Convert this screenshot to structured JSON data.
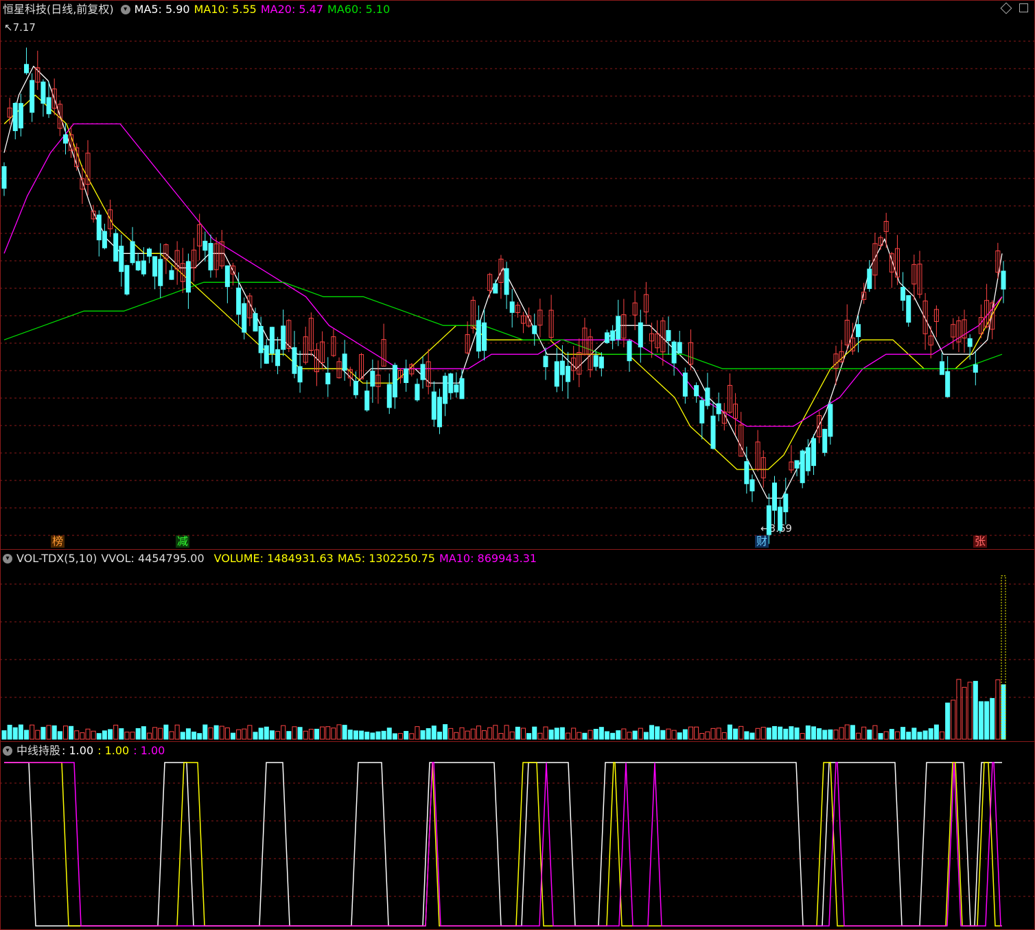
{
  "price_header": {
    "title": "恒星科技(日线,前复权)",
    "ma5": "MA5: 5.90",
    "ma10": "MA10: 5.55",
    "ma20": "MA20: 5.47",
    "ma60": "MA60: 5.10"
  },
  "vol_header": {
    "name": "VOL-TDX(5,10)",
    "vvol": "VVOL: 4454795.00",
    "volume": "VOLUME: 1484931.63",
    "ma5": "MA5: 1302250.75",
    "ma10": "MA10: 869943.31"
  },
  "ind_header": {
    "name": "中线持股",
    "v1": ": 1.00",
    "v2": ": 1.00",
    "v3": ": 1.00"
  },
  "annotations": {
    "high": "7.17",
    "low": "3.69",
    "tag_bang": "榜",
    "tag_jian": "减",
    "tag_cai": "财",
    "tag_zhang": "张"
  },
  "colors": {
    "up": "#ff4444",
    "down": "#54ffff",
    "ma5": "#ffffff",
    "ma10": "#ffff00",
    "ma20": "#ff00ff",
    "ma60": "#00dd00",
    "grid": "#8b1a1a"
  },
  "chart_data": [
    {
      "type": "candlestick",
      "title": "恒星科技(日线,前复权)",
      "ylim": [
        3.69,
        7.17
      ],
      "series": [
        {
          "name": "MA5",
          "values": [
            6.3,
            6.7,
            6.9,
            6.8,
            6.5,
            6.2,
            5.9,
            5.7,
            5.6,
            5.6,
            5.6,
            5.6,
            5.5,
            5.5,
            5.6,
            5.6,
            5.4,
            5.2,
            5.0,
            5.0,
            4.9,
            4.9,
            4.8,
            4.8,
            4.7,
            4.8,
            4.8,
            4.8,
            4.8,
            4.7,
            4.7,
            4.7,
            5.0,
            5.3,
            5.5,
            5.3,
            5.1,
            4.9,
            4.9,
            4.8,
            4.9,
            5.0,
            5.1,
            5.1,
            5.1,
            5.0,
            4.9,
            4.8,
            4.6,
            4.5,
            4.3,
            4.1,
            3.9,
            3.9,
            4.1,
            4.3,
            4.5,
            4.8,
            5.1,
            5.5,
            5.7,
            5.4,
            5.3,
            5.1,
            4.9,
            4.9,
            4.9,
            5.0,
            5.6
          ]
        },
        {
          "name": "MA10",
          "values": [
            6.5,
            6.6,
            6.7,
            6.6,
            6.5,
            6.2,
            6.0,
            5.8,
            5.7,
            5.6,
            5.6,
            5.5,
            5.4,
            5.3,
            5.2,
            5.1,
            5.0,
            4.9,
            4.9,
            4.8,
            4.8,
            4.8,
            4.8,
            4.7,
            4.7,
            4.7,
            4.8,
            4.9,
            5.0,
            5.1,
            5.1,
            5.0,
            5.0,
            5.0,
            5.0,
            5.0,
            4.9,
            4.9,
            4.9,
            4.9,
            4.9,
            4.8,
            4.7,
            4.6,
            4.4,
            4.3,
            4.2,
            4.1,
            4.1,
            4.1,
            4.2,
            4.4,
            4.6,
            4.8,
            4.9,
            5.0,
            5.0,
            5.0,
            4.9,
            4.8,
            4.8,
            4.8,
            4.9,
            5.1,
            5.3
          ]
        },
        {
          "name": "MA20",
          "values": [
            5.6,
            6.0,
            6.3,
            6.5,
            6.5,
            6.5,
            6.3,
            6.1,
            5.9,
            5.7,
            5.6,
            5.5,
            5.4,
            5.3,
            5.1,
            5.0,
            4.9,
            4.8,
            4.8,
            4.8,
            4.8,
            4.9,
            4.9,
            4.9,
            5.0,
            5.0,
            5.0,
            5.0,
            4.9,
            4.8,
            4.6,
            4.5,
            4.4,
            4.4,
            4.4,
            4.5,
            4.6,
            4.8,
            4.9,
            4.9,
            4.9,
            5.0,
            5.1,
            5.3
          ]
        },
        {
          "name": "MA60",
          "values": [
            5.0,
            5.1,
            5.2,
            5.2,
            5.3,
            5.4,
            5.4,
            5.4,
            5.3,
            5.3,
            5.2,
            5.1,
            5.1,
            5.0,
            5.0,
            4.9,
            4.9,
            4.9,
            4.8,
            4.8,
            4.8,
            4.8,
            4.8,
            4.8,
            4.8,
            4.9
          ]
        }
      ]
    },
    {
      "type": "bar",
      "title": "VOL-TDX(5,10)",
      "series": [
        {
          "name": "VOLUME",
          "values": [
            1484931.63
          ]
        },
        {
          "name": "MA5",
          "values": [
            1302250.75
          ]
        },
        {
          "name": "MA10",
          "values": [
            869943.31
          ]
        }
      ],
      "vvol": 4454795.0
    },
    {
      "type": "line",
      "title": "中线持股",
      "ylim": [
        0,
        1
      ],
      "series": [
        {
          "name": "line1",
          "values": [
            1.0
          ]
        },
        {
          "name": "line2",
          "values": [
            1.0
          ]
        },
        {
          "name": "line3",
          "values": [
            1.0
          ]
        }
      ]
    }
  ]
}
